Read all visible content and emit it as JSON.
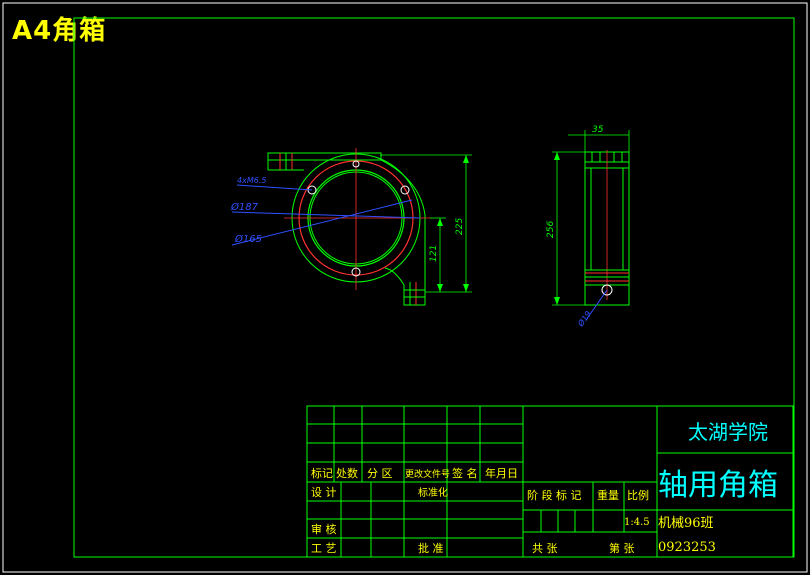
{
  "sheet": {
    "label": "A4角箱"
  },
  "front_view": {
    "dims": {
      "holes": "4xM6.5",
      "dia_outer": "Ø187",
      "dia_inner": "Ø165",
      "height_total": "225",
      "height_center": "121"
    }
  },
  "side_view": {
    "dims": {
      "width": "35",
      "height": "256",
      "hole": "Ø19"
    }
  },
  "title_block": {
    "school": "太湖学院",
    "part_name": "轴用角箱",
    "headers": {
      "mark": "标记",
      "count": "处数",
      "zone": "分 区",
      "change_doc": "更改文件号",
      "sign": "签 名",
      "date": "年月日"
    },
    "design": "设 计",
    "standard": "标准化",
    "review": "审 核",
    "process": "工 艺",
    "approve": "批 准",
    "stage_mark": "阶 段 标 记",
    "weight": "重量",
    "scale": "比例",
    "scale_value": "1:4.5",
    "class_name": "机械96班",
    "student_id": "0923253",
    "total_sheets": "共   张",
    "sheet_no": "第   张"
  }
}
